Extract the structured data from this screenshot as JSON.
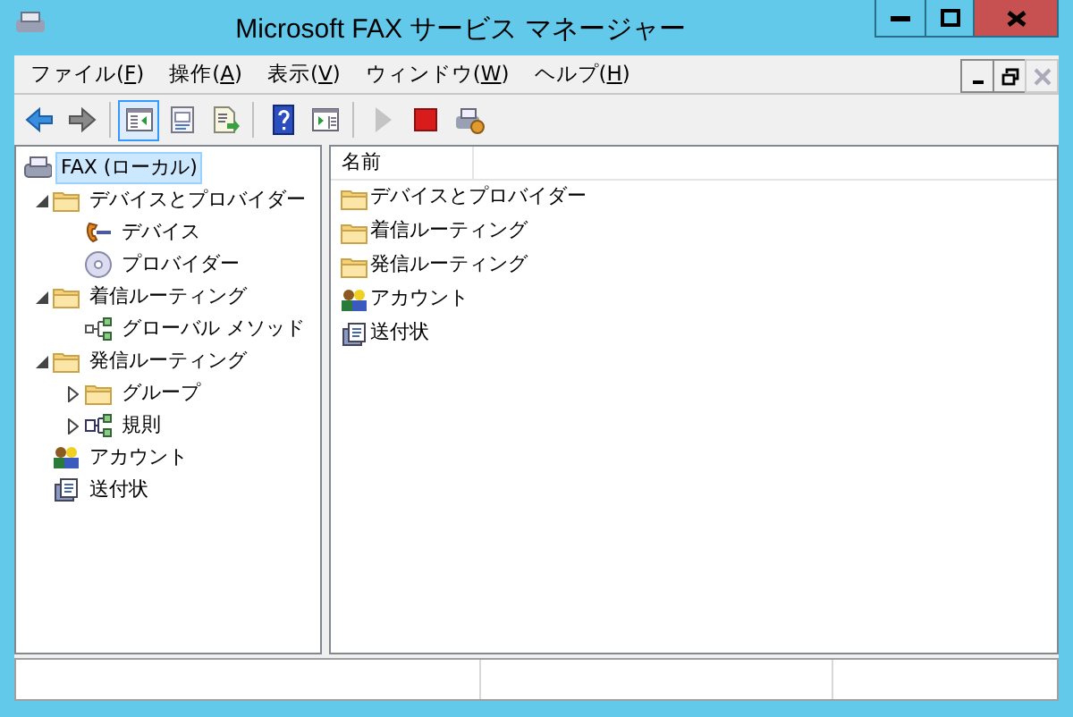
{
  "window": {
    "title": "Microsoft FAX サービス マネージャー"
  },
  "menu": [
    {
      "before": "ファイル(",
      "key": "F",
      "after": ")"
    },
    {
      "before": "操作(",
      "key": "A",
      "after": ")"
    },
    {
      "before": "表示(",
      "key": "V",
      "after": ")"
    },
    {
      "before": "ウィンドウ(",
      "key": "W",
      "after": ")"
    },
    {
      "before": "ヘルプ(",
      "key": "H",
      "after": ")"
    }
  ],
  "mdi_buttons": [
    {
      "kind": "minimize",
      "disabled": false
    },
    {
      "kind": "restore",
      "disabled": false
    },
    {
      "kind": "close",
      "disabled": true
    }
  ],
  "toolbar": [
    {
      "kind": "back",
      "pressed": false,
      "disabled": false
    },
    {
      "kind": "forward",
      "pressed": false,
      "disabled": false
    },
    {
      "kind": "sep"
    },
    {
      "kind": "tree",
      "pressed": true,
      "disabled": false
    },
    {
      "kind": "properties",
      "pressed": false,
      "disabled": false
    },
    {
      "kind": "export",
      "pressed": false,
      "disabled": false
    },
    {
      "kind": "sep"
    },
    {
      "kind": "help",
      "pressed": false,
      "disabled": false
    },
    {
      "kind": "pane",
      "pressed": false,
      "disabled": false
    },
    {
      "kind": "sep"
    },
    {
      "kind": "play",
      "pressed": false,
      "disabled": true
    },
    {
      "kind": "stop",
      "pressed": false,
      "disabled": false
    },
    {
      "kind": "faxconfig",
      "pressed": false,
      "disabled": false
    }
  ],
  "tree": [
    {
      "label": "FAX (ローカル)",
      "kind": "fax",
      "selected": true,
      "children": [
        {
          "label": "デバイスとプロバイダー",
          "kind": "folder",
          "selected": false,
          "expanded": true,
          "children": [
            {
              "label": "デバイス",
              "kind": "phone",
              "selected": false
            },
            {
              "label": "プロバイダー",
              "kind": "disc",
              "selected": false
            }
          ]
        },
        {
          "label": "着信ルーティング",
          "kind": "folder",
          "selected": false,
          "expanded": true,
          "children": [
            {
              "label": "グローバル メソッド",
              "kind": "routing",
              "selected": false
            }
          ]
        },
        {
          "label": "発信ルーティング",
          "kind": "folder",
          "selected": false,
          "expanded": true,
          "children": [
            {
              "label": "グループ",
              "kind": "folder",
              "selected": false,
              "expanded": false
            },
            {
              "label": "規則",
              "kind": "rules",
              "selected": false,
              "expanded": false
            }
          ]
        },
        {
          "label": "アカウント",
          "kind": "accounts",
          "selected": false
        },
        {
          "label": "送付状",
          "kind": "cover",
          "selected": false
        }
      ]
    }
  ],
  "list": {
    "columns": [
      "名前"
    ],
    "items": [
      {
        "label": "デバイスとプロバイダー",
        "kind": "folder"
      },
      {
        "label": "着信ルーティング",
        "kind": "folder"
      },
      {
        "label": "発信ルーティング",
        "kind": "folder"
      },
      {
        "label": "アカウント",
        "kind": "accounts"
      },
      {
        "label": "送付状",
        "kind": "cover"
      }
    ]
  }
}
